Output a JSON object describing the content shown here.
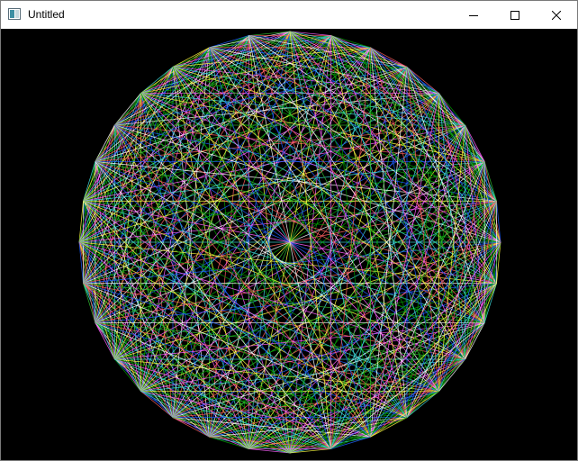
{
  "window": {
    "title": "Untitled",
    "app_icon": "window-app-icon",
    "controls": {
      "minimize_icon": "minimize-icon",
      "maximize_icon": "maximize-icon",
      "close_icon": "close-icon"
    }
  },
  "canvas": {
    "background": "#000000",
    "figure": "string-art-circle",
    "line_colors": [
      "#ff6060",
      "#ffff40",
      "#30c030",
      "#40e0e0",
      "#ffffff",
      "#ff60ff",
      "#2060ff",
      "#00a000"
    ]
  }
}
